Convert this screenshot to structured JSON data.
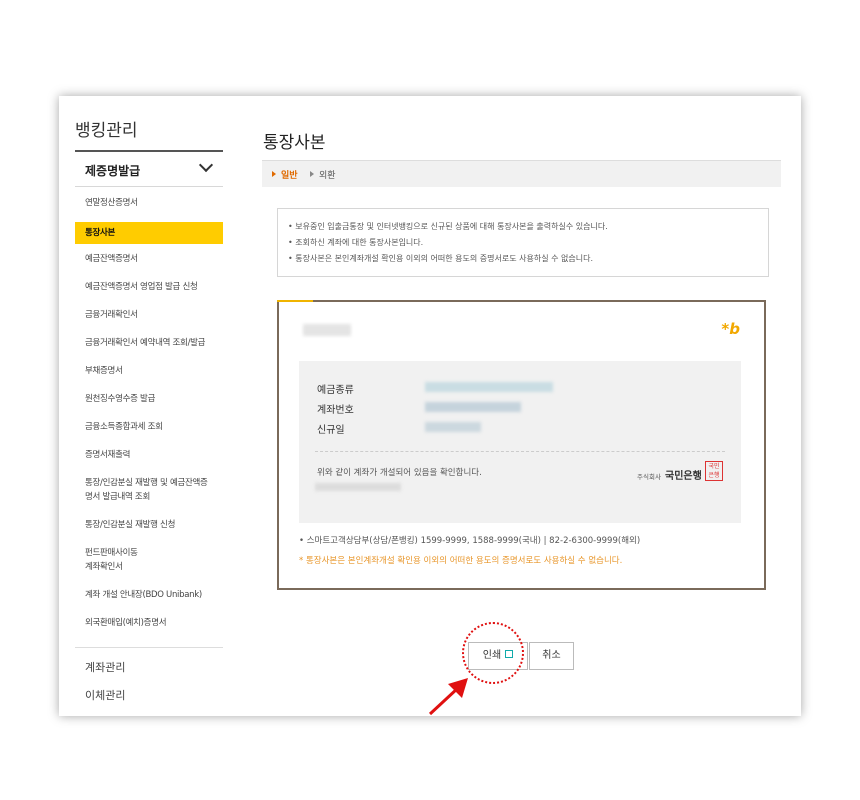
{
  "sidebar": {
    "title": "뱅킹관리",
    "section": "제증명발급",
    "items": [
      {
        "label": "연말정산증명서"
      },
      {
        "label": "통장사본",
        "active": true
      },
      {
        "label": "예금잔액증명서"
      },
      {
        "label": "예금잔액증명서 영업점 발급 신청"
      },
      {
        "label": "금융거래확인서"
      },
      {
        "label": "금융거래확인서 예약내역 조회/발급"
      },
      {
        "label": "부채증명서"
      },
      {
        "label": "원천징수영수증 발급"
      },
      {
        "label": "금융소득종합과세 조회"
      },
      {
        "label": "증명서재출력"
      },
      {
        "label": "통장/인감분실 재발행 및 예금잔액증",
        "label2": "명서 발급내역 조회"
      },
      {
        "label": "통장/인감분실 재발행 신청"
      },
      {
        "label": "펀드판매사이동",
        "label2": "계좌확인서"
      },
      {
        "label": "계좌 개설 안내장(BDO Unibank)"
      },
      {
        "label": "외국환매입(예치)증명서"
      }
    ],
    "bottom": [
      "계좌관리",
      "이체관리"
    ]
  },
  "main": {
    "title": "통장사본",
    "tabs": [
      {
        "label": "일반",
        "active": true
      },
      {
        "label": "외환"
      }
    ],
    "notices": [
      "보유중인 입출금통장 및 인터넷뱅킹으로 신규된 상품에 대해 통장사본을 출력하실수 있습니다.",
      "조회하신 계좌에 대한 통장사본입니다.",
      "통장사본은 본인계좌개설 확인용 이외의 어떠한 용도의 증명서로도 사용하실 수 없습니다."
    ],
    "certificate": {
      "logo": "*b",
      "labels": [
        "예금종류",
        "계좌번호",
        "신규일"
      ],
      "confirm_text": "위와 같이 계좌가 개설되어 있음을 확인합니다.",
      "bank_prefix": "주식회사",
      "bank_name": "국민은행",
      "seal_text": "국민은행",
      "contact": "스마트고객상담부(상담/폰뱅킹) 1599-9999, 1588-9999(국내) | 82-2-6300-9999(해외)",
      "warning": "* 통장사본은 본인계좌개설 확인용 이외의 어떠한 용도의 증명서로도 사용하실 수 없습니다."
    },
    "buttons": {
      "print": "인쇄",
      "cancel": "취소"
    }
  },
  "colors": {
    "active_item": "#ffcc00",
    "tab_active": "#e06a00",
    "warning": "#e8962a",
    "annotation": "#e01010"
  }
}
